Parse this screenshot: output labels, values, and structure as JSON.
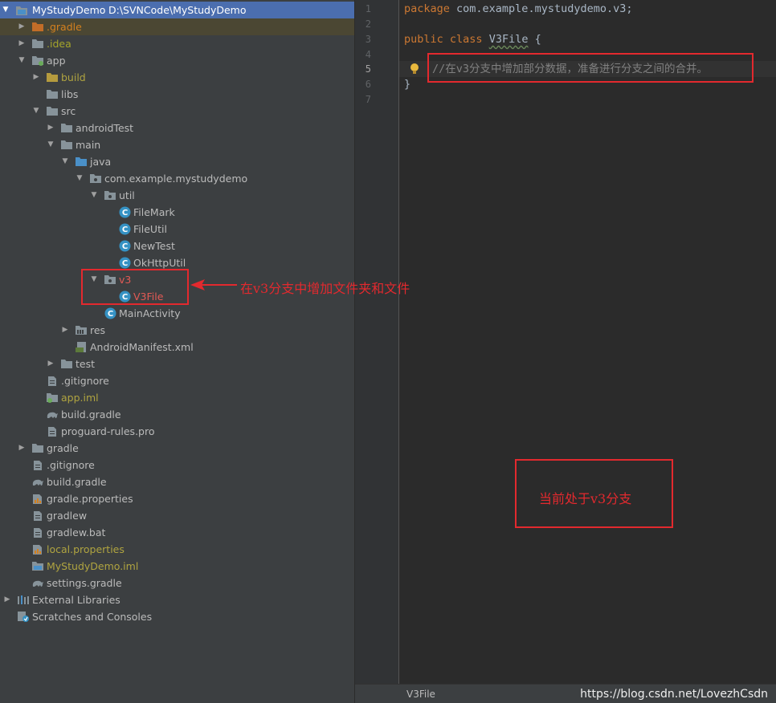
{
  "project_tree": {
    "root_label": "MyStudyDemo",
    "root_path": "D:\\SVNCode\\MyStudyDemo",
    "items": [
      {
        "label": ".gradle"
      },
      {
        "label": ".idea"
      },
      {
        "label": "app"
      },
      {
        "label": "build"
      },
      {
        "label": "libs"
      },
      {
        "label": "src"
      },
      {
        "label": "androidTest"
      },
      {
        "label": "main"
      },
      {
        "label": "java"
      },
      {
        "label": "com.example.mystudydemo"
      },
      {
        "label": "util"
      },
      {
        "label": "FileMark"
      },
      {
        "label": "FileUtil"
      },
      {
        "label": "NewTest"
      },
      {
        "label": "OkHttpUtil"
      },
      {
        "label": "v3"
      },
      {
        "label": "V3File"
      },
      {
        "label": "MainActivity"
      },
      {
        "label": "res"
      },
      {
        "label": "AndroidManifest.xml"
      },
      {
        "label": "test"
      },
      {
        "label": ".gitignore"
      },
      {
        "label": "app.iml"
      },
      {
        "label": "build.gradle"
      },
      {
        "label": "proguard-rules.pro"
      },
      {
        "label": "gradle"
      },
      {
        "label": ".gitignore"
      },
      {
        "label": "build.gradle"
      },
      {
        "label": "gradle.properties"
      },
      {
        "label": "gradlew"
      },
      {
        "label": "gradlew.bat"
      },
      {
        "label": "local.properties"
      },
      {
        "label": "MyStudyDemo.iml"
      },
      {
        "label": "settings.gradle"
      },
      {
        "label": "External Libraries"
      },
      {
        "label": "Scratches and Consoles"
      }
    ]
  },
  "editor": {
    "line_numbers": [
      "1",
      "2",
      "3",
      "4",
      "5",
      "6",
      "7"
    ],
    "current_line": "5",
    "line1": {
      "keyword": "package",
      "rest": " com.example.mystudydemo.v3;"
    },
    "line3": {
      "kw1": "public",
      "kw2": "class",
      "class_name": "V3File",
      "brace": " {"
    },
    "line5": {
      "comment": "//在v3分支中增加部分数据，准备进行分支之间的合并。"
    },
    "line6": {
      "text": "}"
    }
  },
  "status_bar": {
    "file_tab": "V3File",
    "watermark": "https://blog.csdn.net/LovezhCsdn"
  },
  "annotations": {
    "arrow_note": "在v3分支中增加文件夹和文件",
    "branch_note": "当前处于v3分支"
  },
  "colors": {
    "panel_bg": "#3c3f41",
    "editor_bg": "#2b2b2b",
    "selection": "#4b6eaf",
    "annotation_red": "#e3292e"
  }
}
